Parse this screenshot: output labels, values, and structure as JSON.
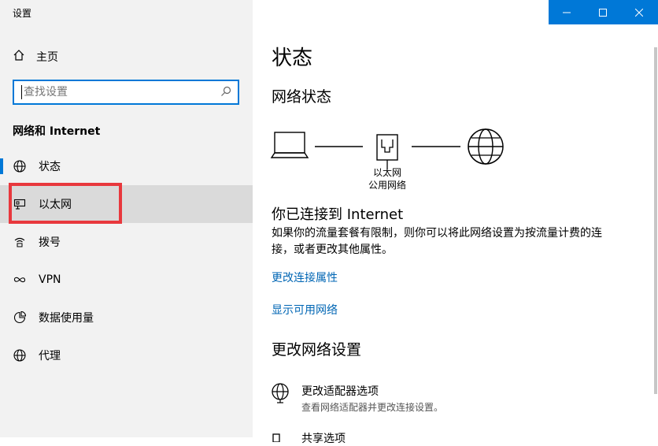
{
  "app": {
    "title": "设置"
  },
  "sidebar": {
    "home_label": "主页",
    "search_placeholder": "查找设置",
    "section_title": "网络和 Internet",
    "items": [
      {
        "label": "状态",
        "icon": "globe-icon"
      },
      {
        "label": "以太网",
        "icon": "ethernet-icon"
      },
      {
        "label": "拨号",
        "icon": "dialup-icon"
      },
      {
        "label": "VPN",
        "icon": "vpn-icon"
      },
      {
        "label": "数据使用量",
        "icon": "data-usage-icon"
      },
      {
        "label": "代理",
        "icon": "proxy-globe-icon"
      }
    ],
    "selected_item": "以太网",
    "highlight_color": "#e8383d"
  },
  "main": {
    "title": "状态",
    "network_status_heading": "网络状态",
    "diagram": {
      "adapter_name": "以太网",
      "network_type": "公用网络"
    },
    "connected_heading": "你已连接到 Internet",
    "connected_desc": "如果你的流量套餐有限制，则你可以将此网络设置为按流量计费的连接，或者更改其他属性。",
    "links": {
      "change_connection_properties": "更改连接属性",
      "show_available_networks": "显示可用网络"
    },
    "change_settings_heading": "更改网络设置",
    "adapter_options": {
      "title": "更改适配器选项",
      "desc": "查看网络适配器并更改连接设置。"
    },
    "sharing_options": {
      "title": "共享选项"
    }
  },
  "colors": {
    "accent": "#0078d7",
    "link": "#0066b4",
    "sidebar_bg": "#f2f2f2"
  }
}
